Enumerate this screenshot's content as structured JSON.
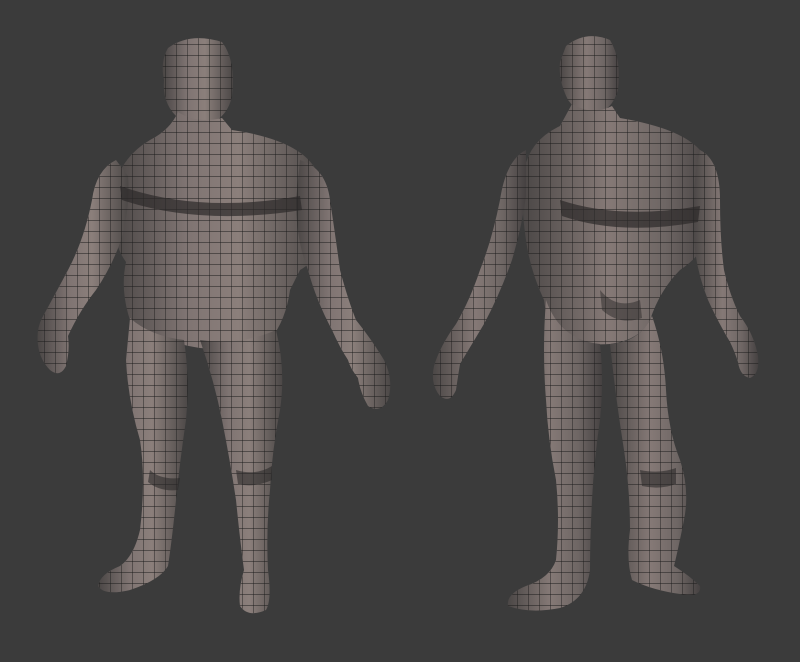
{
  "scene": {
    "background_color": "#3b3b3b",
    "mesh_fill_light": "#8a7d79",
    "mesh_fill_mid": "#6b6462",
    "mesh_fill_dark": "#3e3b3b",
    "wire_color": "#1a1a1a"
  },
  "models": [
    {
      "view": "front",
      "icon": "wireframe-humanoid-front-icon"
    },
    {
      "view": "back",
      "icon": "wireframe-humanoid-back-icon"
    }
  ]
}
